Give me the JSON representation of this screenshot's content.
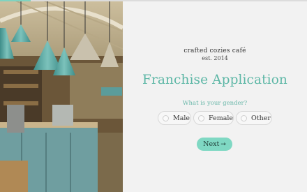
{
  "progress": {
    "percent": 10,
    "fill_color": "#7fd3c0"
  },
  "photo": {
    "alt": "cafe interior with teal pendant lamps"
  },
  "brand": {
    "name": "crafted cozies café",
    "established": "est. 2014"
  },
  "form": {
    "title": "Franchise Application",
    "question": "What is your gender?",
    "options": [
      "Male",
      "Female",
      "Other"
    ],
    "selected": null,
    "next_label": "Next",
    "next_icon": "→"
  },
  "colors": {
    "accent": "#5db7a6",
    "button": "#7fd8c3",
    "background": "#f2f2f2"
  }
}
